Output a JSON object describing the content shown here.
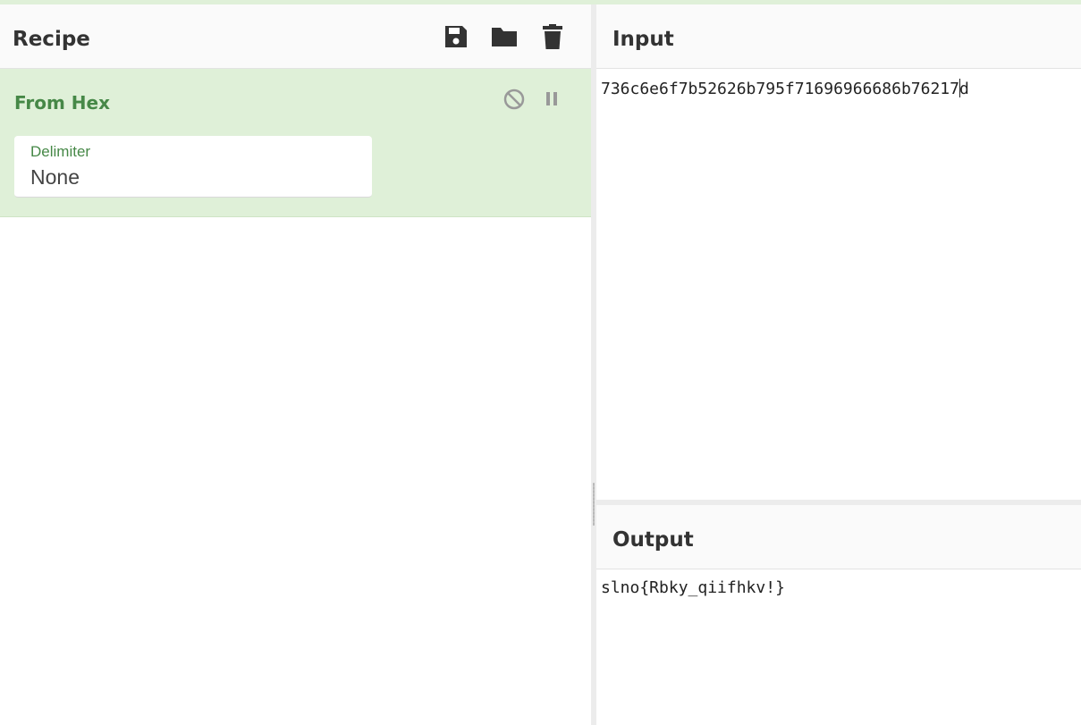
{
  "recipe": {
    "title": "Recipe",
    "buttons": {
      "save_icon": "save-icon",
      "load_icon": "folder-icon",
      "clear_icon": "trash-icon"
    },
    "operation": {
      "name": "From Hex",
      "controls": [
        "disable-icon",
        "pause-icon"
      ],
      "args": [
        {
          "label": "Delimiter",
          "value": "None"
        }
      ]
    }
  },
  "input": {
    "title": "Input",
    "text_before_caret": "736c6e6f7b52626b795f71696966686b76217",
    "text_after_caret": "d"
  },
  "output": {
    "title": "Output",
    "text": "slno{Rbky_qiifhkv!}"
  },
  "colors": {
    "accent_green": "#468847",
    "op_background": "#dff0d8",
    "icon_dark": "#333333"
  }
}
